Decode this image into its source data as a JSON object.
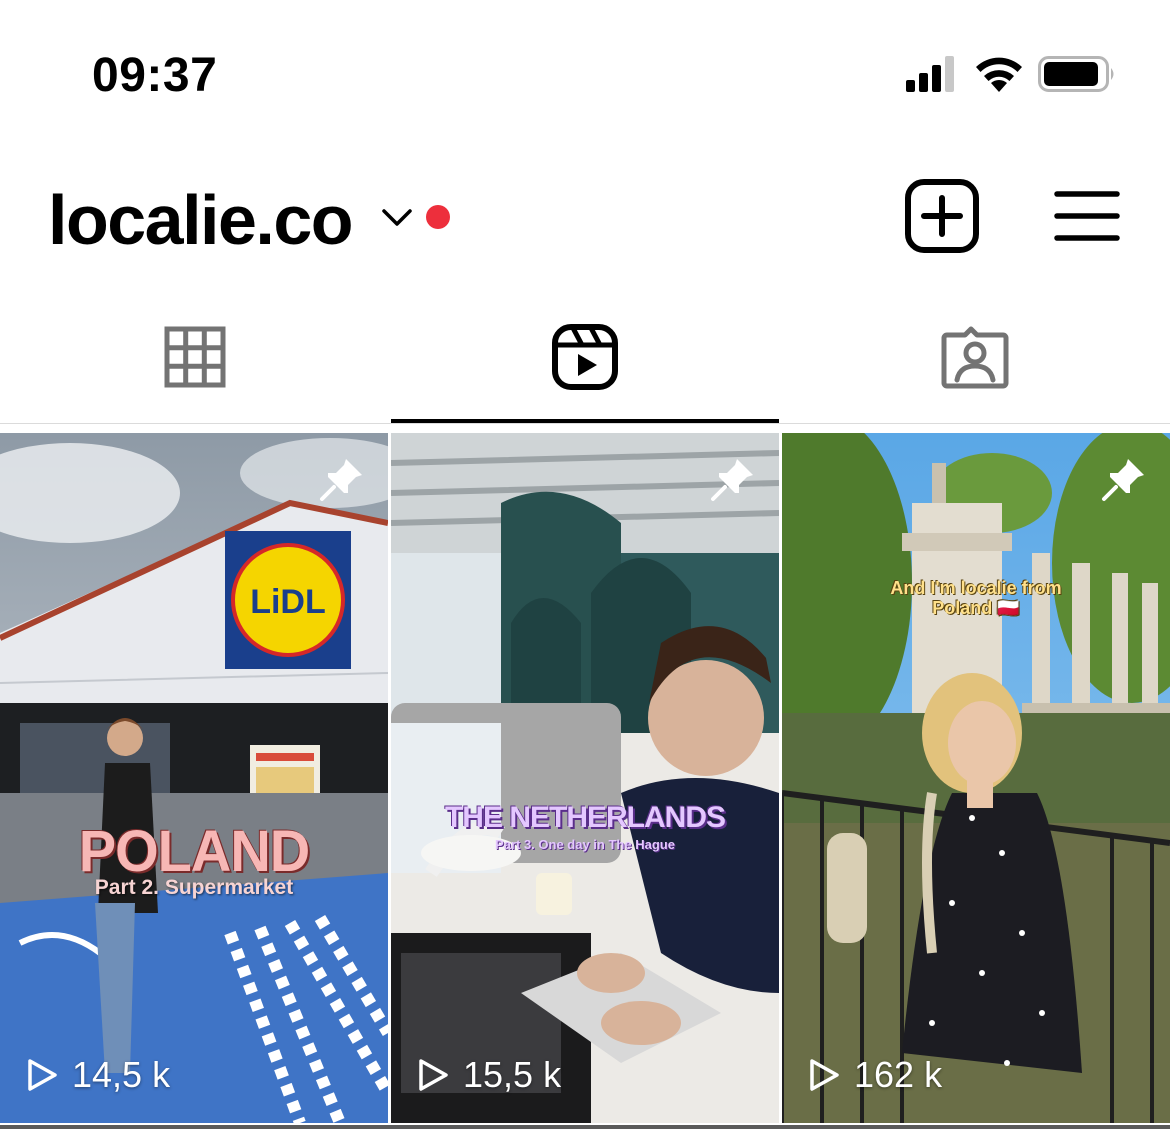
{
  "status_bar": {
    "time": "09:37",
    "icons": [
      "signal-icon",
      "wifi-icon",
      "battery-icon"
    ]
  },
  "header": {
    "username": "localie.co",
    "has_notification_dot": true,
    "notification_color": "#ed2f3c",
    "actions": [
      "new-post-icon",
      "menu-icon"
    ]
  },
  "tabs": [
    {
      "name": "posts",
      "icon": "grid-icon",
      "active": false
    },
    {
      "name": "reels",
      "icon": "reels-icon",
      "active": true
    },
    {
      "name": "tagged",
      "icon": "tagged-person-icon",
      "active": false
    }
  ],
  "reels": [
    {
      "pinned": true,
      "views": "14,5 k",
      "overlay_title": "POLAND",
      "overlay_subtitle": "Part 2. Supermarket",
      "sign_text": "LiDL"
    },
    {
      "pinned": true,
      "views": "15,5 k",
      "overlay_title": "THE NETHERLANDS",
      "overlay_subtitle": "Part 3. One day in The Hague"
    },
    {
      "pinned": true,
      "views": "162 k",
      "overlay_title": "And I'm localie from Poland 🇵🇱"
    }
  ]
}
